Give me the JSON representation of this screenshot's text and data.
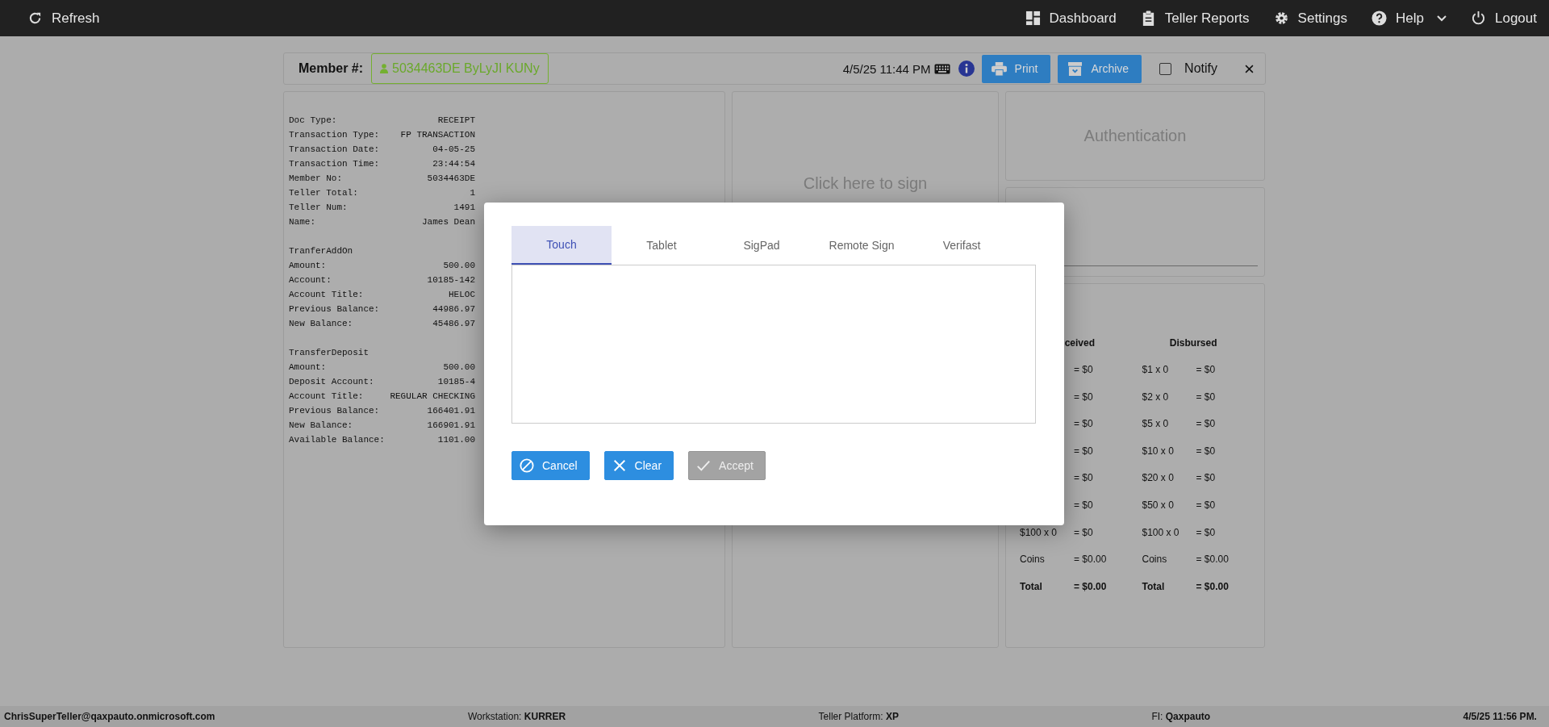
{
  "nav": {
    "left": [
      {
        "label": "Refresh"
      }
    ],
    "right": [
      {
        "label": "Dashboard",
        "dropdown": false
      },
      {
        "label": "Teller Reports",
        "dropdown": false
      },
      {
        "label": "Settings",
        "dropdown": false
      },
      {
        "label": "Help",
        "dropdown": true
      },
      {
        "label": "Logout",
        "dropdown": false
      }
    ]
  },
  "header": {
    "member_label": "Member #:",
    "member_id": "5034463DE ByLyJI KUNy",
    "timestamp": "4/5/25 11:44 PM",
    "buttons": [
      "Print",
      "Archive"
    ],
    "notify": {
      "label": "Notify",
      "checked": false
    }
  },
  "receipt": {
    "groups": [
      {
        "rows": [
          {
            "label": "Doc Type:",
            "value": "RECEIPT"
          },
          {
            "label": "Transaction Type:",
            "value": "FP TRANSACTION"
          },
          {
            "label": "Transaction Date:",
            "value": "04-05-25"
          },
          {
            "label": "Transaction Time:",
            "value": "23:44:54"
          },
          {
            "label": "Member No:",
            "value": "5034463DE"
          },
          {
            "label": "Teller Total:",
            "value": "1"
          },
          {
            "label": "Teller Num:",
            "value": "1491"
          },
          {
            "label": "Name:",
            "value": "James Dean"
          }
        ]
      },
      {
        "title": "TranferAddOn",
        "rows": [
          {
            "label": "Amount:",
            "value": "500.00"
          },
          {
            "label": "Account:",
            "value": "10185-142"
          },
          {
            "label": "Account Title:",
            "value": "HELOC"
          },
          {
            "label": "Previous Balance:",
            "value": "44986.97"
          },
          {
            "label": "New Balance:",
            "value": "45486.97"
          }
        ]
      },
      {
        "title": "TransferDeposit",
        "rows": [
          {
            "label": "Amount:",
            "value": "500.00"
          },
          {
            "label": "Deposit Account:",
            "value": "10185-4"
          },
          {
            "label": "Account Title:",
            "value": "REGULAR CHECKING"
          },
          {
            "label": "Previous Balance:",
            "value": "166401.91"
          },
          {
            "label": "New Balance:",
            "value": "166901.91"
          },
          {
            "label": "Available Balance:",
            "value": "1101.00"
          }
        ]
      }
    ]
  },
  "signature_panel": {
    "prompt": "Click here to sign"
  },
  "authentication": {
    "title": "Authentication"
  },
  "cash": {
    "columns": [
      {
        "heading": "ceived",
        "rows": [
          {
            "amount": "= $0"
          },
          {
            "amount": "= $0"
          },
          {
            "amount": "= $0"
          },
          {
            "amount": "= $0"
          },
          {
            "amount": "= $0"
          },
          {
            "amount": "= $0"
          },
          {
            "label": "$100 x 0",
            "amount": "= $0"
          },
          {
            "label": "Coins",
            "amount": "= $0.00"
          }
        ],
        "total": {
          "label": "Total",
          "amount": "= $0.00"
        }
      },
      {
        "heading": "Disbursed",
        "rows": [
          {
            "label": "$1 x 0",
            "amount": "= $0"
          },
          {
            "label": "$2 x 0",
            "amount": "= $0"
          },
          {
            "label": "$5 x 0",
            "amount": "= $0"
          },
          {
            "label": "$10 x 0",
            "amount": "= $0"
          },
          {
            "label": "$20 x 0",
            "amount": "= $0"
          },
          {
            "label": "$50 x 0",
            "amount": "= $0"
          },
          {
            "label": "$100 x 0",
            "amount": "= $0"
          },
          {
            "label": "Coins",
            "amount": "= $0.00"
          }
        ],
        "total": {
          "label": "Total",
          "amount": "= $0.00"
        }
      }
    ]
  },
  "dialog": {
    "tabs": [
      {
        "label": "Touch",
        "selected": true
      },
      {
        "label": "Tablet",
        "selected": false
      },
      {
        "label": "SigPad",
        "selected": false
      },
      {
        "label": "Remote Sign",
        "selected": false
      },
      {
        "label": "Verifast",
        "selected": false
      }
    ],
    "buttons": [
      {
        "label": "Cancel",
        "disabled": false
      },
      {
        "label": "Clear",
        "disabled": false
      },
      {
        "label": "Accept",
        "disabled": true
      }
    ]
  },
  "status_bar": {
    "user": "ChrisSuperTeller@qaxpauto.onmicrosoft.com",
    "workstation": "Workstation: **KURRER**",
    "platform": "Teller Platform: **XP**",
    "fi": "FI: **Qaxpauto**",
    "time": "4/5/25 11:56 PM."
  }
}
